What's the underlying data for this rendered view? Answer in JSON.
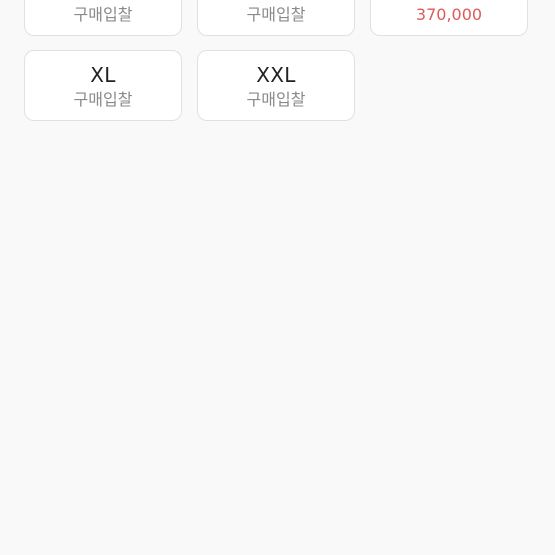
{
  "size_options": [
    {
      "size": "",
      "price": "구매입찰"
    },
    {
      "size": "",
      "price": "구매입찰"
    },
    {
      "size": "",
      "price": "370,000"
    },
    {
      "size": "XL",
      "price": "구매입찰"
    },
    {
      "size": "XXL",
      "price": "구매입찰"
    }
  ],
  "colors": {
    "background": "#f9f9f9",
    "card_background": "#ffffff",
    "card_border": "#e1e1e1",
    "price_highlight": "#e05a5a",
    "bid_text": "#8a8a8a"
  }
}
